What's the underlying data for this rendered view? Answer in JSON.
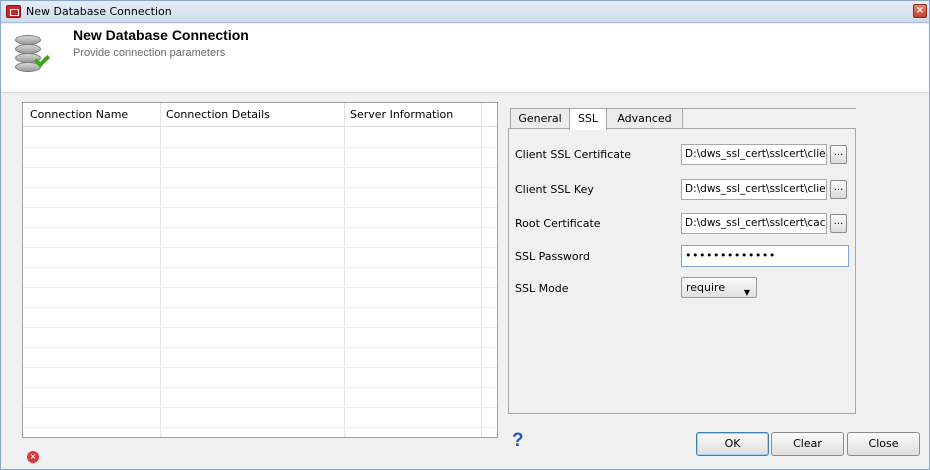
{
  "window": {
    "title": "New Database Connection",
    "close_glyph": "×"
  },
  "header": {
    "title": "New Database Connection",
    "subtitle": "Provide connection parameters"
  },
  "table": {
    "columns": [
      "Connection Name",
      "Connection Details",
      "Server Information"
    ]
  },
  "tabs": [
    "General",
    "SSL",
    "Advanced"
  ],
  "active_tab": "SSL",
  "ssl_form": {
    "client_cert_label": "Client SSL Certificate",
    "client_cert_value": "D:\\dws_ssl_cert\\sslcert\\clie",
    "client_key_label": "Client SSL Key",
    "client_key_value": "D:\\dws_ssl_cert\\sslcert\\clie",
    "root_cert_label": "Root Certificate",
    "root_cert_value": "D:\\dws_ssl_cert\\sslcert\\cac",
    "password_label": "SSL Password",
    "password_value": "•••••••••••••",
    "mode_label": "SSL Mode",
    "mode_value": "require",
    "browse_label": "..."
  },
  "buttons": {
    "help": "?",
    "ok": "OK",
    "clear": "Clear",
    "close": "Close"
  },
  "icons": {
    "app": "app-icon",
    "database": "database-icon",
    "error": "error-icon",
    "help": "help-icon"
  }
}
